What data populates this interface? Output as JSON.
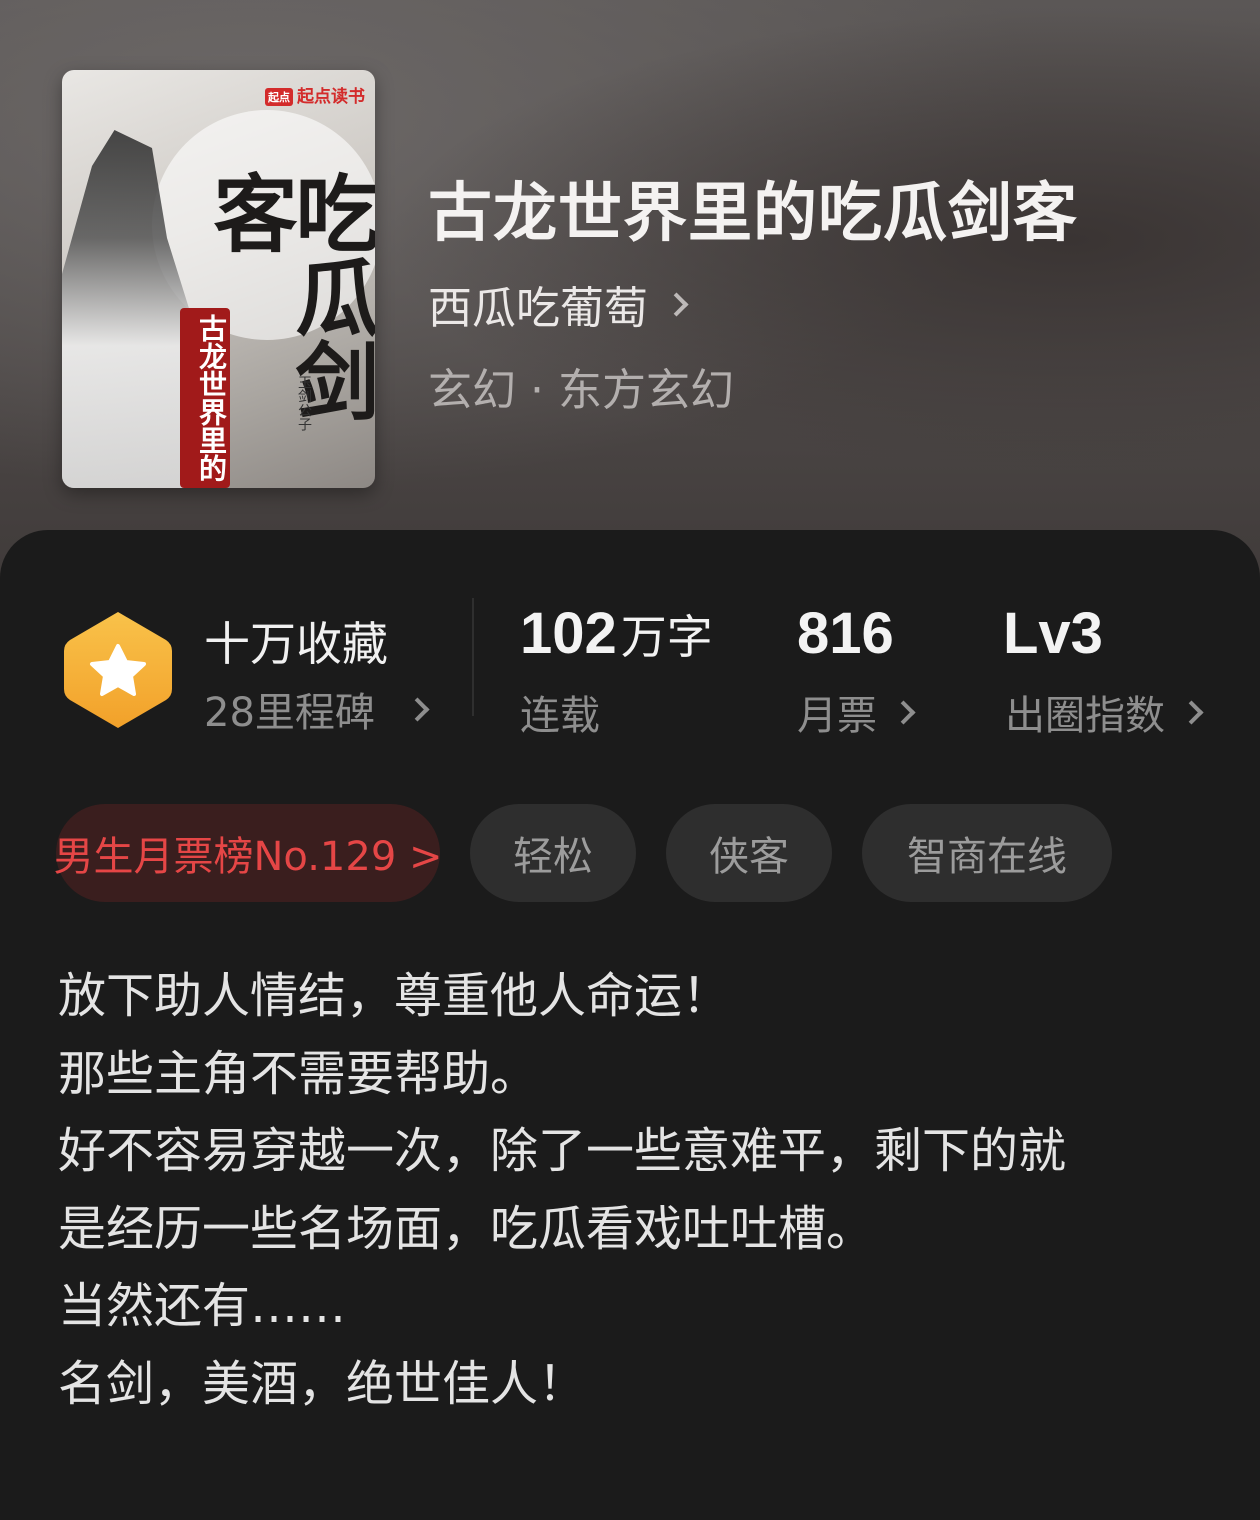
{
  "book": {
    "title": "古龙世界里的吃瓜剑客",
    "author": "西瓜吃葡萄",
    "genre": "玄幻 · 东方玄幻",
    "cover": {
      "brand_tag": "起点",
      "brand": "起点读书",
      "big_title": "吃瓜剑客",
      "sub_title": "古龙世界里的",
      "author_mark": "玉剑公子"
    }
  },
  "stats": {
    "collect": {
      "title": "十万收藏",
      "sub": "28里程碑"
    },
    "words": {
      "value": "102",
      "unit": "万字",
      "label": "连载"
    },
    "tickets": {
      "value": "816",
      "label": "月票"
    },
    "influence": {
      "value": "Lv3",
      "label": "出圈指数"
    }
  },
  "tags": {
    "rank": "男生月票榜No.129 >",
    "items": [
      "轻松",
      "侠客",
      "智商在线"
    ]
  },
  "description": {
    "lines": [
      "放下助人情结，尊重他人命运！",
      "那些主角不需要帮助。",
      "好不容易穿越一次，除了一些意难平，剩下的就",
      "是经历一些名场面，吃瓜看戏吐吐槽。",
      "当然还有……",
      "名剑，美酒，绝世佳人！"
    ]
  },
  "colors": {
    "badge": "#f7b23b",
    "rank_text": "#e54646",
    "panel": "#1b1b1b"
  },
  "icons": [
    "star-badge-icon",
    "chevron-right-icon"
  ]
}
